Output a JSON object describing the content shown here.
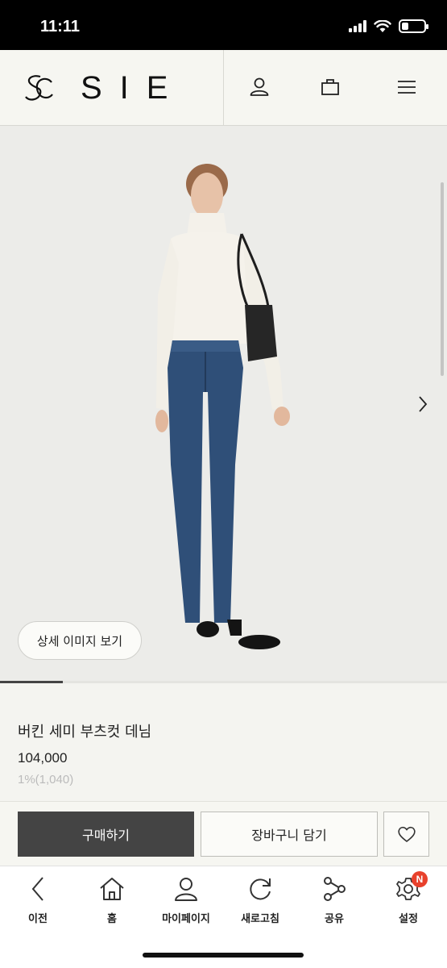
{
  "status_bar": {
    "time": "11:11"
  },
  "header": {
    "brand": "SIE"
  },
  "hero": {
    "detail_button_label": "상세 이미지 보기",
    "gallery_progress": 0.14
  },
  "product": {
    "name": "버킨 세미 부츠컷 데님",
    "price": "104,000",
    "points": "1%(1,040)"
  },
  "actions": {
    "buy_label": "구매하기",
    "cart_label": "장바구니 담기"
  },
  "bottom_nav": {
    "items": [
      {
        "label": "이전",
        "icon": "back-arrow-icon"
      },
      {
        "label": "홈",
        "icon": "home-icon"
      },
      {
        "label": "마이페이지",
        "icon": "person-icon"
      },
      {
        "label": "새로고침",
        "icon": "refresh-icon"
      },
      {
        "label": "공유",
        "icon": "share-icon"
      },
      {
        "label": "설정",
        "icon": "gear-icon",
        "badge": "N"
      }
    ]
  },
  "colors": {
    "accent_dark": "#444444",
    "badge": "#e8412c",
    "background": "#f4f4f0"
  }
}
